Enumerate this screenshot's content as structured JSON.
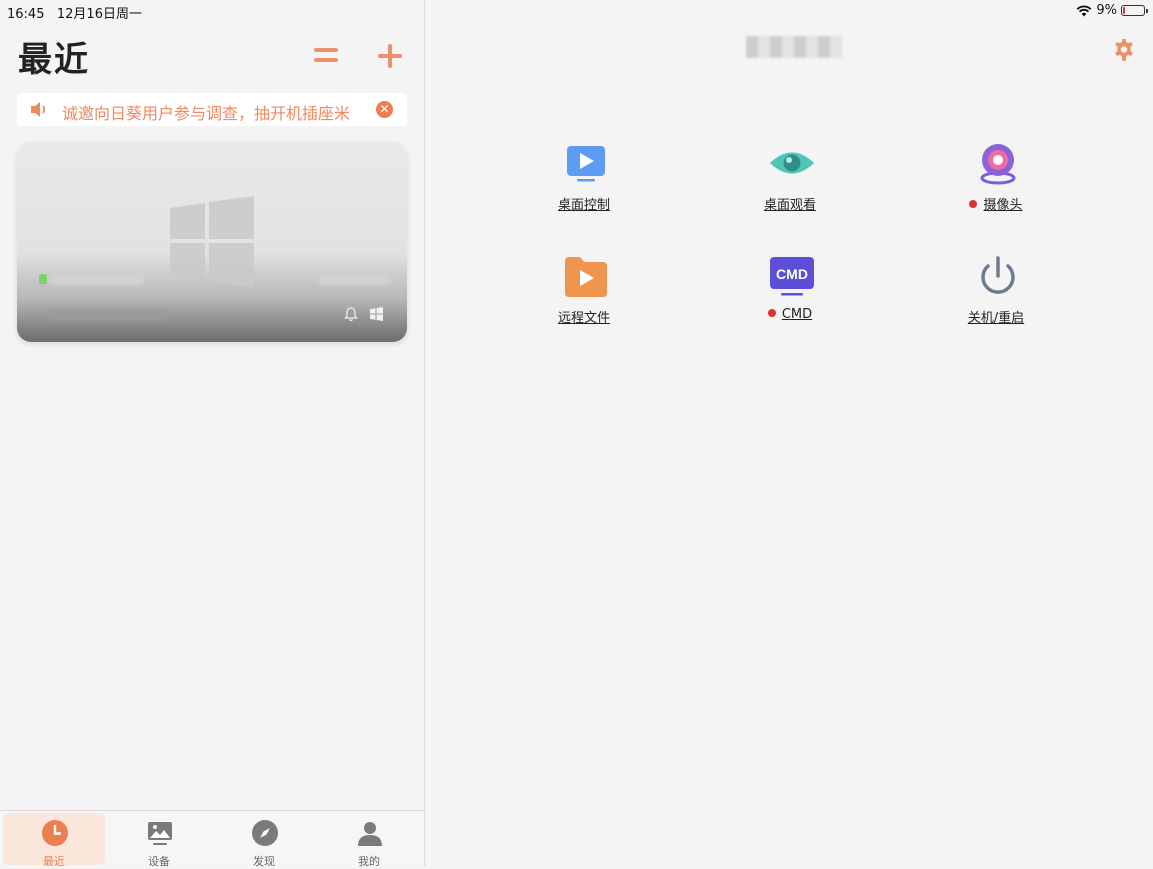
{
  "status_bar": {
    "time": "16:45",
    "date": "12月16日周一",
    "battery": "9%"
  },
  "left": {
    "title": "最近",
    "notice": {
      "text": "诚邀向日葵用户参与调查，抽开机插座米"
    },
    "device_card": {
      "os": "windows"
    }
  },
  "tabs": [
    {
      "label": "最近",
      "icon": "clock-icon",
      "active": true
    },
    {
      "label": "设备",
      "icon": "image-icon",
      "active": false
    },
    {
      "label": "发现",
      "icon": "compass-icon",
      "active": false
    },
    {
      "label": "我的",
      "icon": "user-icon",
      "active": false
    }
  ],
  "functions": [
    {
      "label": "桌面控制",
      "icon": "desktop-control-icon",
      "dot": false
    },
    {
      "label": "桌面观看",
      "icon": "eye-icon",
      "dot": false
    },
    {
      "label": "摄像头",
      "icon": "camera-icon",
      "dot": true
    },
    {
      "label": "远程文件",
      "icon": "folder-icon",
      "dot": false
    },
    {
      "label": "CMD",
      "icon": "cmd-icon",
      "dot": true,
      "icon_text": "CMD"
    },
    {
      "label": "关机/重启",
      "icon": "power-icon",
      "dot": false
    }
  ],
  "colors": {
    "accent": "#ec7f4f",
    "dot": "#e0302a"
  }
}
